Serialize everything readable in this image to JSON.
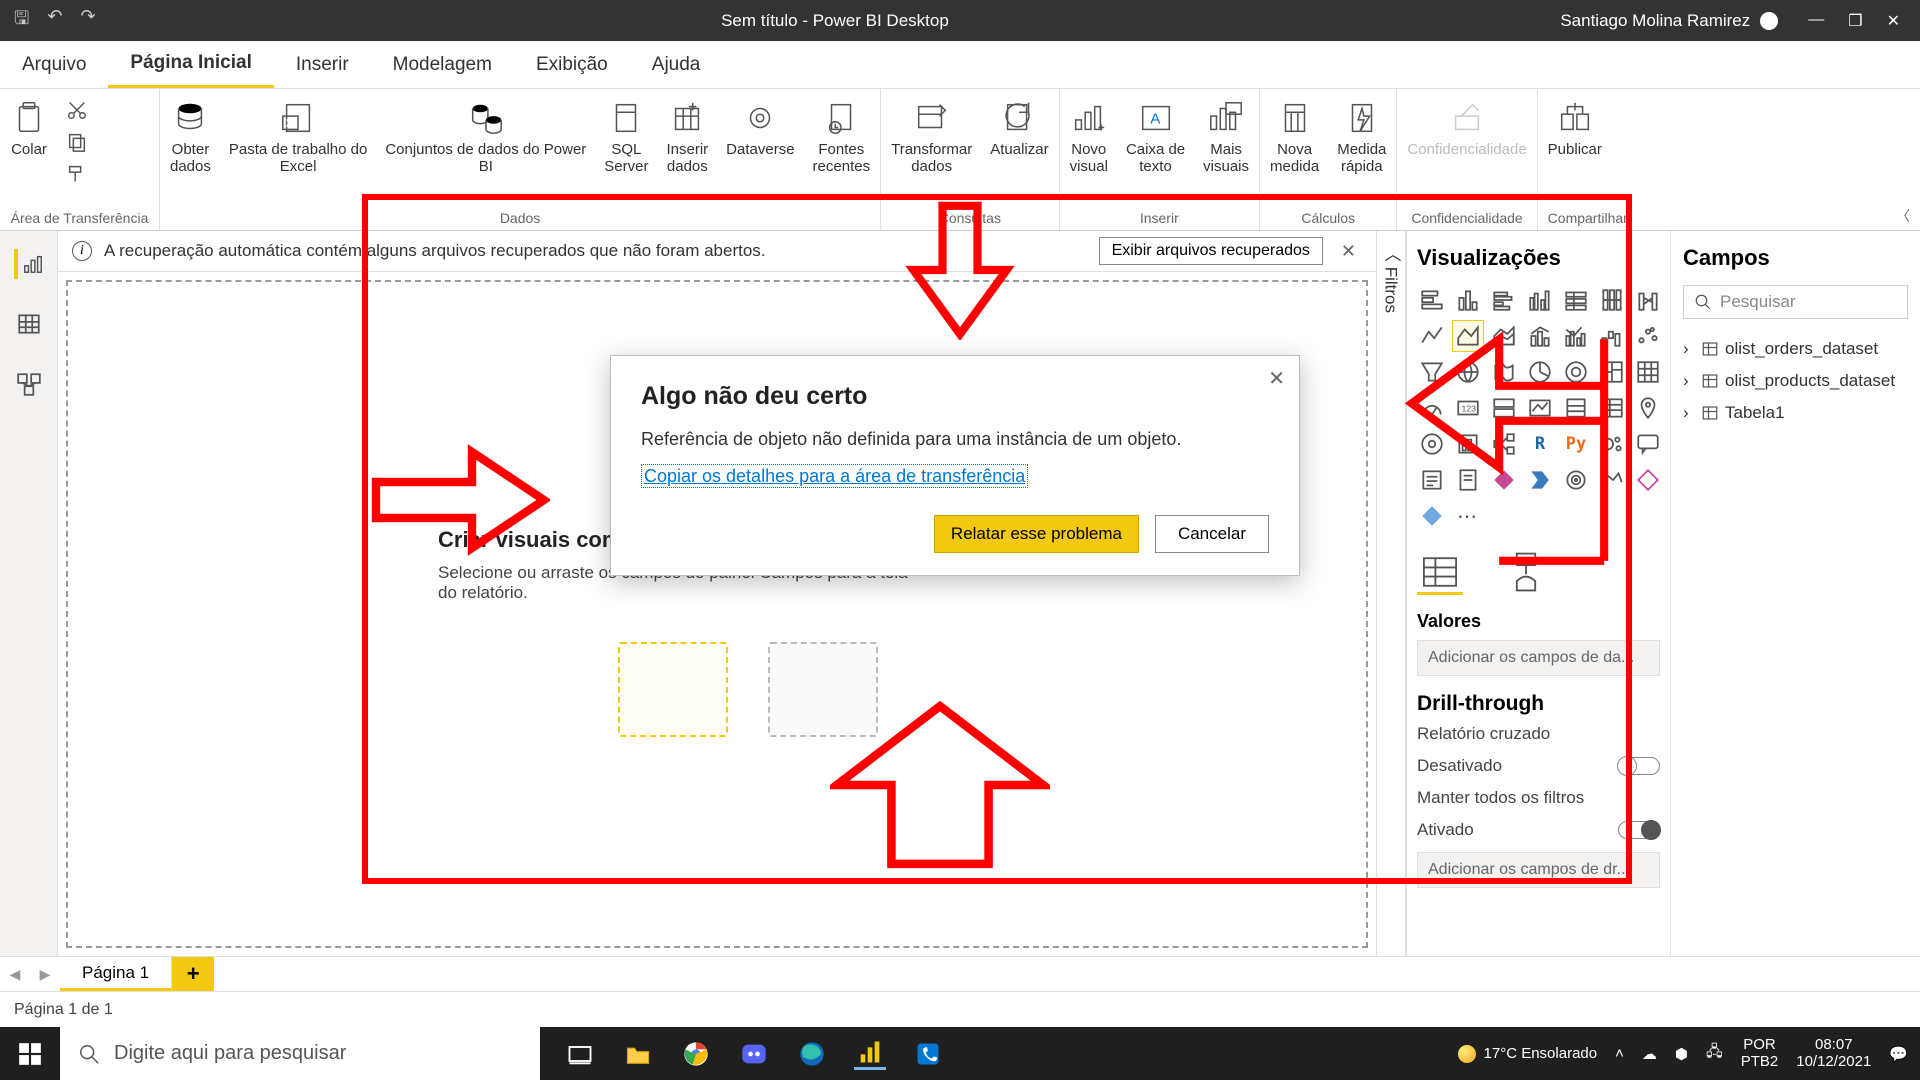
{
  "titlebar": {
    "title": "Sem título - Power BI Desktop",
    "user": "Santiago Molina Ramirez"
  },
  "tabs": {
    "arquivo": "Arquivo",
    "inicial": "Página Inicial",
    "inserir": "Inserir",
    "modelagem": "Modelagem",
    "exibicao": "Exibição",
    "ajuda": "Ajuda"
  },
  "ribbon": {
    "transferencia": {
      "colar": "Colar",
      "group": "Área de Transferência"
    },
    "dados": {
      "obter": "Obter\ndados",
      "excel": "Pasta de trabalho do\nExcel",
      "pbi": "Conjuntos de dados do Power\nBI",
      "sql": "SQL\nServer",
      "inserir": "Inserir\ndados",
      "dataverse": "Dataverse",
      "recentes": "Fontes\nrecentes",
      "group": "Dados"
    },
    "consultas": {
      "transformar": "Transformar\ndados",
      "atualizar": "Atualizar",
      "group": "Consultas"
    },
    "inserirg": {
      "novo": "Novo\nvisual",
      "caixa": "Caixa de\ntexto",
      "mais": "Mais\nvisuais",
      "group": "Inserir"
    },
    "calculos": {
      "medida": "Nova\nmedida",
      "rapida": "Medida\nrápida",
      "group": "Cálculos"
    },
    "conf": {
      "label": "Confidencialidade",
      "group": "Confidencialidade"
    },
    "compart": {
      "publicar": "Publicar",
      "group": "Compartilhar"
    }
  },
  "recovery": {
    "msg": "A recuperação automática contém alguns arquivos recuperados que não foram abertos.",
    "show": "Exibir arquivos recuperados"
  },
  "canvas": {
    "title": "Criar visuais com seus dados",
    "sub": "Selecione ou arraste os campos do painel Campos para a tela do relatório."
  },
  "filters_tab": "Filtros",
  "viz": {
    "title": "Visualizações",
    "valores": "Valores",
    "add_fields": "Adicionar os campos de da...",
    "drill_title": "Drill-through",
    "cross": "Relatório cruzado",
    "desativado": "Desativado",
    "manter": "Manter todos os filtros",
    "ativado": "Ativado",
    "add_drill": "Adicionar os campos de dr..."
  },
  "fields": {
    "title": "Campos",
    "search_ph": "Pesquisar",
    "tables": [
      "olist_orders_dataset",
      "olist_products_dataset",
      "Tabela1"
    ]
  },
  "pagetabs": {
    "page1": "Página 1"
  },
  "pbistatus": "Página 1 de 1",
  "modal": {
    "title": "Algo não deu certo",
    "msg": "Referência de objeto não definida para uma instância de um objeto.",
    "copy": "Copiar os detalhes para a área de transferência",
    "report": "Relatar esse problema",
    "cancel": "Cancelar"
  },
  "taskbar": {
    "search_ph": "Digite aqui para pesquisar",
    "weather": "17°C  Ensolarado",
    "lang1": "POR",
    "lang2": "PTB2",
    "time": "08:07",
    "date": "10/12/2021"
  }
}
